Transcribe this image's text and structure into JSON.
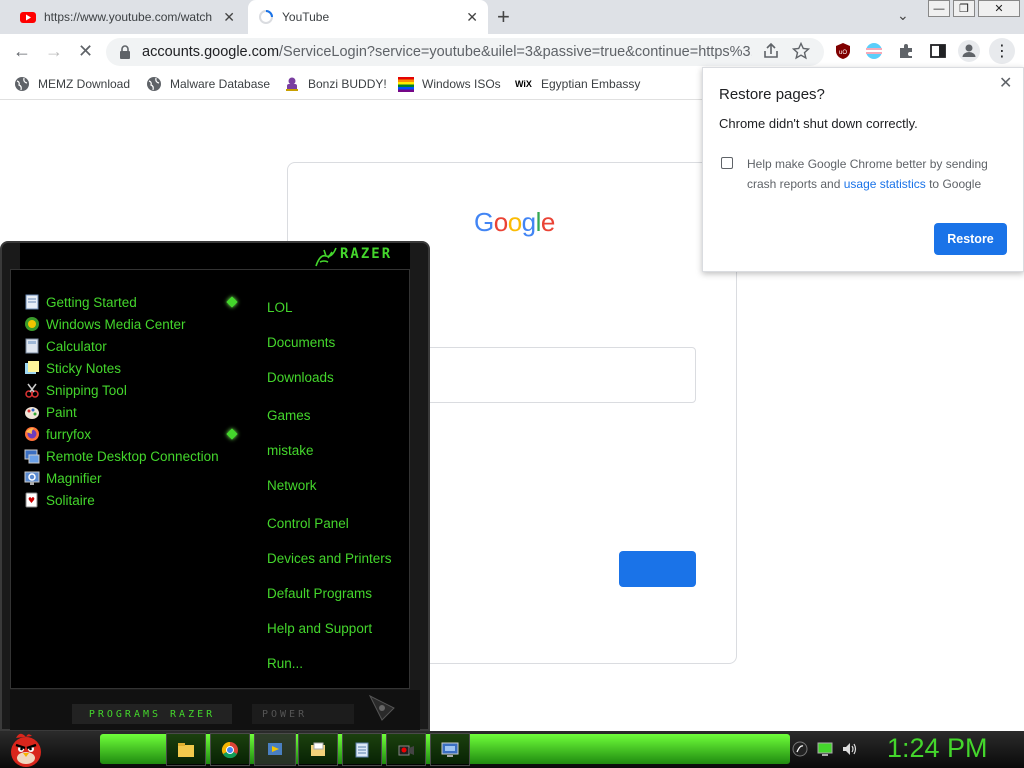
{
  "browser": {
    "tabs": [
      {
        "title": "https://www.youtube.com/watch",
        "icon": "youtube-icon"
      },
      {
        "title": "YouTube",
        "icon": "loading-spinner-icon"
      }
    ],
    "url": {
      "host": "accounts.google.com",
      "path": "/ServiceLogin?service=youtube&uilel=3&passive=true&continue=https%3..."
    },
    "bookmarks": [
      {
        "label": "MEMZ Download",
        "icon": "globe-icon"
      },
      {
        "label": "Malware Database",
        "icon": "globe-icon"
      },
      {
        "label": "Bonzi BUDDY!",
        "icon": "bonzi-icon"
      },
      {
        "label": "Windows ISOs",
        "icon": "windows-flag-icon"
      },
      {
        "label": "Egyptian Embassy",
        "icon": "wix-icon"
      }
    ]
  },
  "google": {
    "logo": "Google"
  },
  "restore_popup": {
    "title": "Restore pages?",
    "message": "Chrome didn't shut down correctly.",
    "help_text_before": "Help make Google Chrome better by sending crash reports and ",
    "help_link": "usage statistics",
    "help_text_after": " to Google",
    "button": "Restore"
  },
  "start_menu": {
    "brand": "RAZER",
    "programs": [
      {
        "label": "Getting Started",
        "icon": "getting-started-icon",
        "has_arrow": true
      },
      {
        "label": "Windows Media Center",
        "icon": "media-center-icon",
        "has_arrow": false
      },
      {
        "label": "Calculator",
        "icon": "calculator-icon",
        "has_arrow": false
      },
      {
        "label": "Sticky Notes",
        "icon": "sticky-notes-icon",
        "has_arrow": false
      },
      {
        "label": "Snipping Tool",
        "icon": "snipping-tool-icon",
        "has_arrow": false
      },
      {
        "label": "Paint",
        "icon": "paint-icon",
        "has_arrow": false
      },
      {
        "label": "furryfox",
        "icon": "firefox-icon",
        "has_arrow": true
      },
      {
        "label": "Remote Desktop Connection",
        "icon": "remote-desktop-icon",
        "has_arrow": false
      },
      {
        "label": "Magnifier",
        "icon": "magnifier-icon",
        "has_arrow": false
      },
      {
        "label": "Solitaire",
        "icon": "solitaire-icon",
        "has_arrow": false
      }
    ],
    "places": [
      "LOL",
      "Documents",
      "Downloads",
      "Games",
      "mistake",
      "Network",
      "Control Panel",
      "Devices and Printers",
      "Default Programs",
      "Help and Support",
      "Run..."
    ],
    "all_programs": "PROGRAMS RAZER",
    "power": "POWER"
  },
  "taskbar": {
    "clock": "1:24 PM",
    "pinned": [
      "folder-icon",
      "chrome-icon",
      "media-player-icon",
      "explorer-icon",
      "notepad-icon",
      "video-recorder-icon",
      "remote-desktop-icon"
    ]
  },
  "colors": {
    "razer_green": "#44d62c",
    "chrome_blue": "#1a73e8"
  }
}
